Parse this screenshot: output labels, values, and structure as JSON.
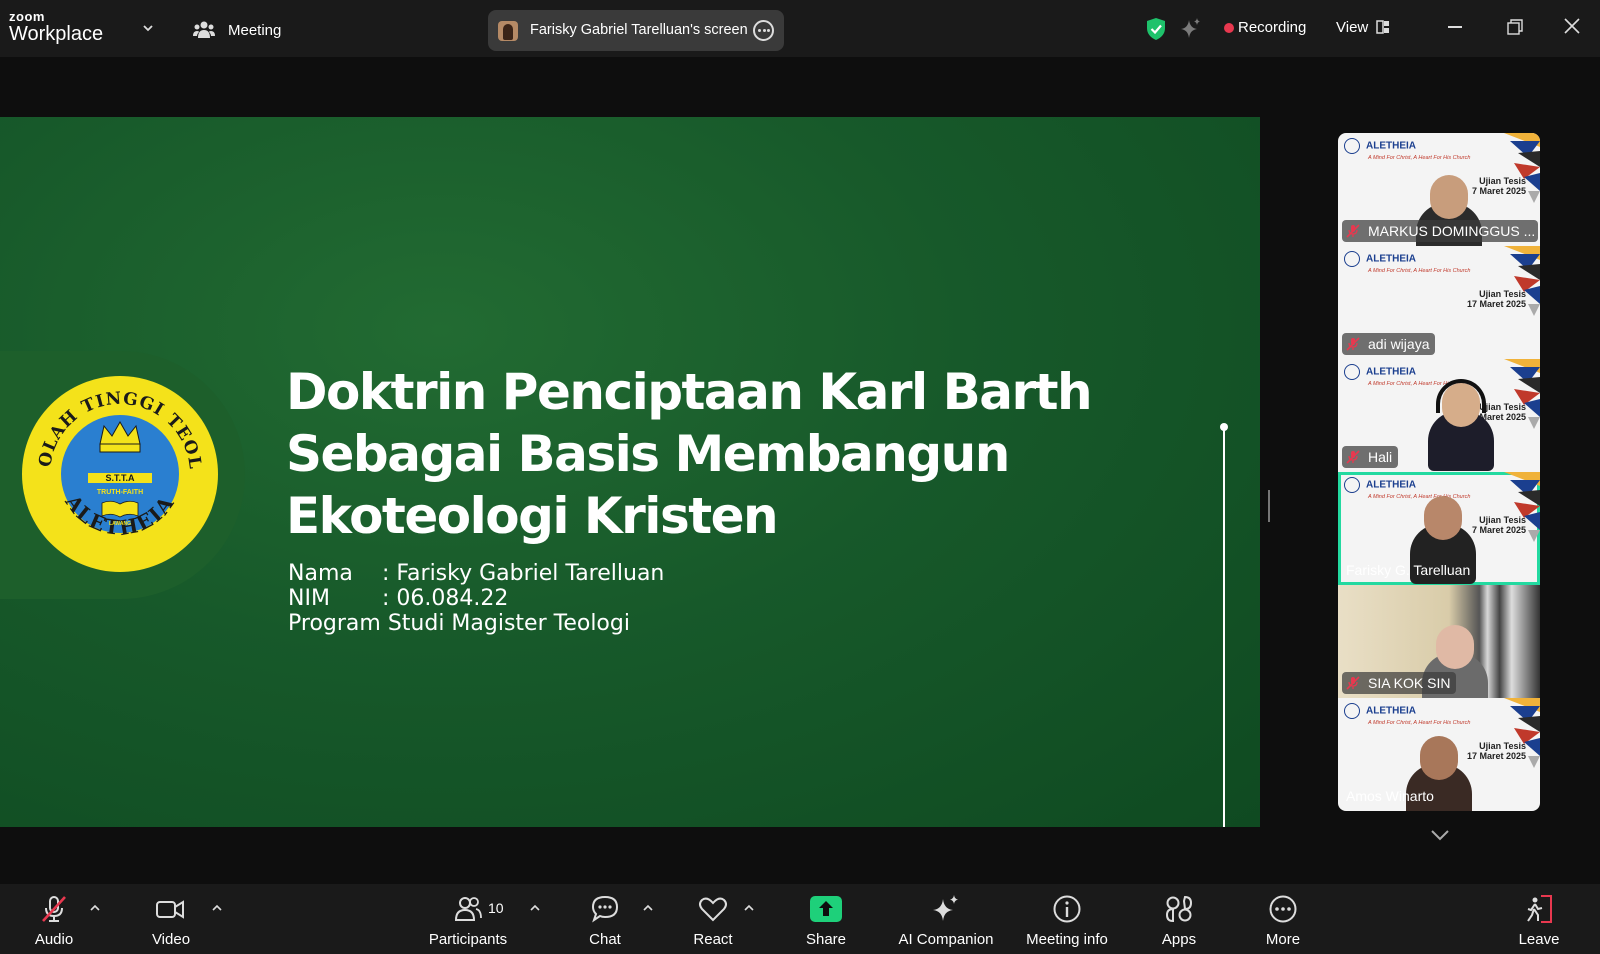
{
  "topbar": {
    "brand_small": "zoom",
    "brand_large": "Workplace",
    "meeting_label": "Meeting",
    "share_label": "Farisky Gabriel Tarelluan's screen",
    "recording_label": "Recording",
    "view_label": "View",
    "colors": {
      "recording": "#e8384f",
      "shield": "#1ec26b"
    }
  },
  "slide": {
    "title_lines": [
      "Doktrin Penciptaan Karl Barth",
      "Sebagai Basis Membangun",
      "Ekoteologi Kristen"
    ],
    "meta": [
      {
        "key": "Nama",
        "value": ": Farisky Gabriel Tarelluan"
      },
      {
        "key": "NIM",
        "value": ": 06.084.22"
      },
      {
        "key": "Program Studi Magister Teologi",
        "value": ""
      }
    ],
    "logo": {
      "ring_text_top": "SEKOLAH TINGGI TEOLOGI",
      "ring_text_bottom": "ALETHEIA",
      "center_abbr": "S.T.T.A",
      "center_motto": "TRUTH-FAITH",
      "center_city": "LAWANG"
    },
    "colors": {
      "background": "#17592a",
      "logo_yellow": "#f4e21a",
      "logo_blue": "#2a7fd0"
    }
  },
  "gallery": {
    "background_text": {
      "institution": "ALETHEIA",
      "tagline": "A Mind For Christ, A Heart For His Church",
      "event_line1": "Ujian Tesis",
      "event_line2": "17 Maret 2025",
      "event_line2_cropped": "7 Maret 2025"
    },
    "tiles": [
      {
        "name": "MARKUS DOMINGGUS ...",
        "muted": true,
        "active": false
      },
      {
        "name": "adi wijaya",
        "muted": true,
        "active": false
      },
      {
        "name": "Hali",
        "muted": true,
        "active": false
      },
      {
        "name": "Farisky G. Tarelluan",
        "muted": false,
        "active": true
      },
      {
        "name": "SIA KOK SIN",
        "muted": true,
        "active": false
      },
      {
        "name": "Amos Winarto",
        "muted": false,
        "active": false
      }
    ],
    "active_color": "#23d9a0"
  },
  "toolbar": {
    "audio": "Audio",
    "video": "Video",
    "participants": "Participants",
    "participants_count": "10",
    "chat": "Chat",
    "react": "React",
    "share": "Share",
    "ai_companion": "AI Companion",
    "meeting_info": "Meeting info",
    "apps": "Apps",
    "more": "More",
    "leave": "Leave",
    "colors": {
      "share": "#1ed07a",
      "leave": "#e8384f",
      "muted": "#e8384f"
    }
  }
}
